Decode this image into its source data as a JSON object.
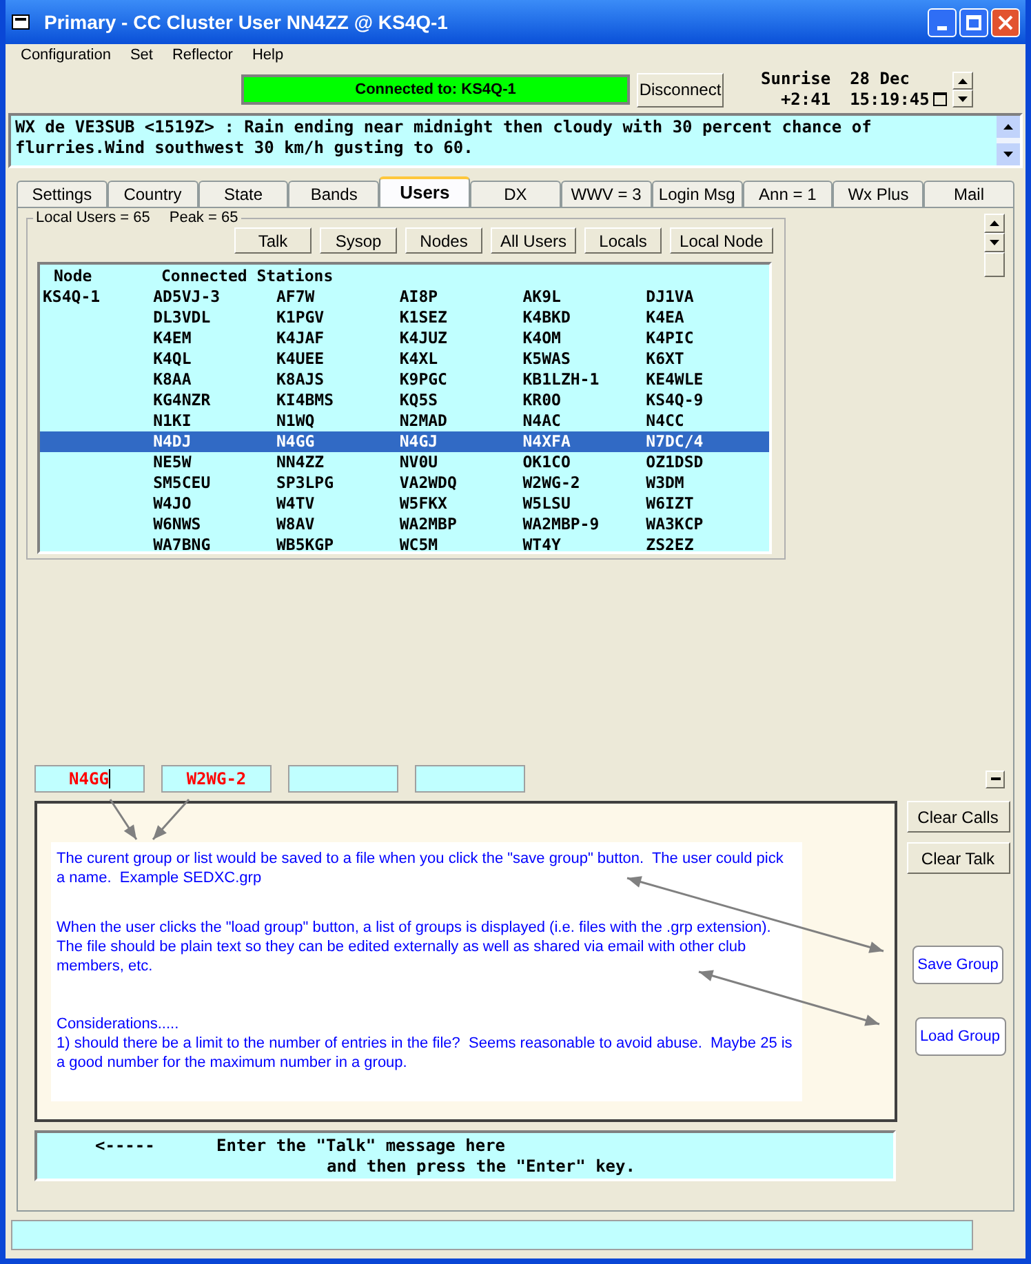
{
  "window": {
    "title": "Primary - CC Cluster User NN4ZZ @ KS4Q-1"
  },
  "menu": [
    "Configuration",
    "Set",
    "Reflector",
    "Help"
  ],
  "connection": {
    "status": "Connected to:  KS4Q-1",
    "connected": true,
    "button": "Disconnect"
  },
  "clock": {
    "label": "Sunrise",
    "offset": "+2:41",
    "date": "28 Dec",
    "time": "15:19:45"
  },
  "wx_message": "WX de VE3SUB <1519Z> : Rain ending near midnight then cloudy with 30 percent chance of flurries.Wind southwest 30 km/h gusting to 60.",
  "tabs": [
    {
      "label": "Settings",
      "selected": false
    },
    {
      "label": "Country",
      "selected": false
    },
    {
      "label": "State",
      "selected": false
    },
    {
      "label": "Bands",
      "selected": false
    },
    {
      "label": "Users",
      "selected": true
    },
    {
      "label": "DX",
      "selected": false
    },
    {
      "label": "WWV = 3",
      "selected": false
    },
    {
      "label": "Login Msg",
      "selected": false
    },
    {
      "label": "Ann = 1",
      "selected": false
    },
    {
      "label": "Wx Plus",
      "selected": false
    },
    {
      "label": "Mail",
      "selected": false
    }
  ],
  "users_panel": {
    "summary": "Local Users = 65",
    "peak": "Peak = 65",
    "buttons": [
      "Talk",
      "Sysop",
      "Nodes",
      "All Users",
      "Locals",
      "Local Node"
    ],
    "columns": [
      "Node",
      "Connected Stations"
    ],
    "rows": [
      {
        "node": "KS4Q-1",
        "stations": [
          "AD5VJ-3",
          "AF7W",
          "AI8P",
          "AK9L",
          "DJ1VA"
        ],
        "selected": false
      },
      {
        "stations": [
          "DL3VDL",
          "K1PGV",
          "K1SEZ",
          "K4BKD",
          "K4EA"
        ],
        "selected": false
      },
      {
        "stations": [
          "K4EM",
          "K4JAF",
          "K4JUZ",
          "K4OM",
          "K4PIC"
        ],
        "selected": false
      },
      {
        "stations": [
          "K4QL",
          "K4UEE",
          "K4XL",
          "K5WAS",
          "K6XT"
        ],
        "selected": false
      },
      {
        "stations": [
          "K8AA",
          "K8AJS",
          "K9PGC",
          "KB1LZH-1",
          "KE4WLE"
        ],
        "selected": false
      },
      {
        "stations": [
          "KG4NZR",
          "KI4BMS",
          "KQ5S",
          "KR0O",
          "KS4Q-9"
        ],
        "selected": false
      },
      {
        "stations": [
          "N1KI",
          "N1WQ",
          "N2MAD",
          "N4AC",
          "N4CC"
        ],
        "selected": false
      },
      {
        "stations": [
          "N4DJ",
          "N4GG",
          "N4GJ",
          "N4XFA",
          "N7DC/4"
        ],
        "selected": true
      },
      {
        "stations": [
          "NE5W",
          "NN4ZZ",
          "NV0U",
          "OK1CO",
          "OZ1DSD"
        ],
        "selected": false
      },
      {
        "stations": [
          "SM5CEU",
          "SP3LPG",
          "VA2WDQ",
          "W2WG-2",
          "W3DM"
        ],
        "selected": false
      },
      {
        "stations": [
          "W4JO",
          "W4TV",
          "W5FKX",
          "W5LSU",
          "W6IZT"
        ],
        "selected": false
      },
      {
        "stations": [
          "W6NWS",
          "W8AV",
          "WA2MBP",
          "WA2MBP-9",
          "WA3KCP"
        ],
        "selected": false
      },
      {
        "stations": [
          "WA7BNG",
          "WB5KGP",
          "WC5M",
          "WT4Y",
          "ZS2EZ"
        ],
        "selected": false
      }
    ]
  },
  "call_fields": [
    {
      "value": "N4GG",
      "focused": true
    },
    {
      "value": "W2WG-2",
      "focused": false
    },
    {
      "focused": false
    },
    {
      "focused": false
    }
  ],
  "notes": [
    "The curent group or list would be saved to a file when you click the \"save group\" button.  The user could pick a name.  Example SEDXC.grp",
    "When the user clicks the \"load group\" button, a list of groups is displayed (i.e. files with the .grp extension).  The file should be plain text so they can be edited externally as well as shared via email with other club members, etc.",
    "Considerations.....",
    "1) should there be a limit to the number of entries in the file?  Seems reasonable to avoid abuse.  Maybe 25 is a good number for the maximum number in a group."
  ],
  "side_buttons": [
    "Clear Calls",
    "Clear Talk"
  ],
  "group_buttons": [
    "Save Group",
    "Load Group"
  ],
  "talk_prompt": {
    "arrow": "<-----",
    "lines": [
      "Enter the \"Talk\" message here",
      "and then press the \"Enter\" key."
    ]
  }
}
